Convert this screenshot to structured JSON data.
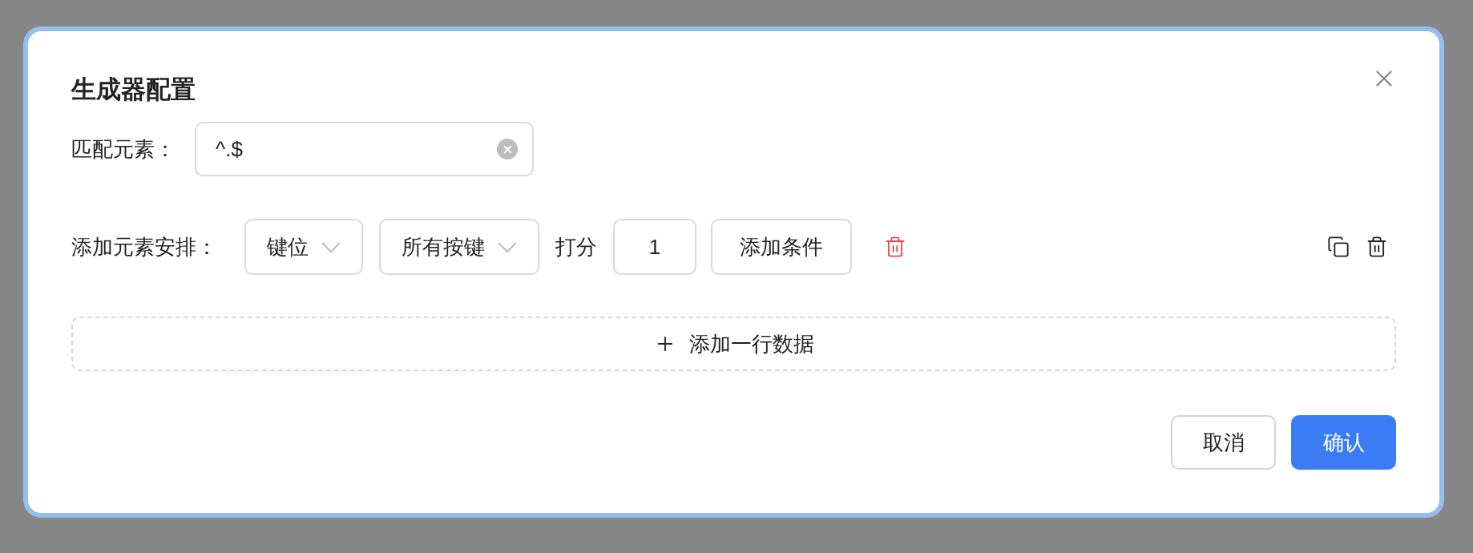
{
  "dialog": {
    "title": "生成器配置",
    "match": {
      "label": "匹配元素：",
      "value": "^.$"
    },
    "arrangement": {
      "label": "添加元素安排：",
      "selects": [
        {
          "value": "键位"
        },
        {
          "value": "所有按键"
        }
      ],
      "score_label": "打分",
      "score": "1",
      "add_condition": "添加条件"
    },
    "add_row": "添加一行数据",
    "buttons": [
      {
        "label": "取消",
        "kind": "secondary"
      },
      {
        "label": "确认",
        "kind": "primary"
      }
    ]
  }
}
